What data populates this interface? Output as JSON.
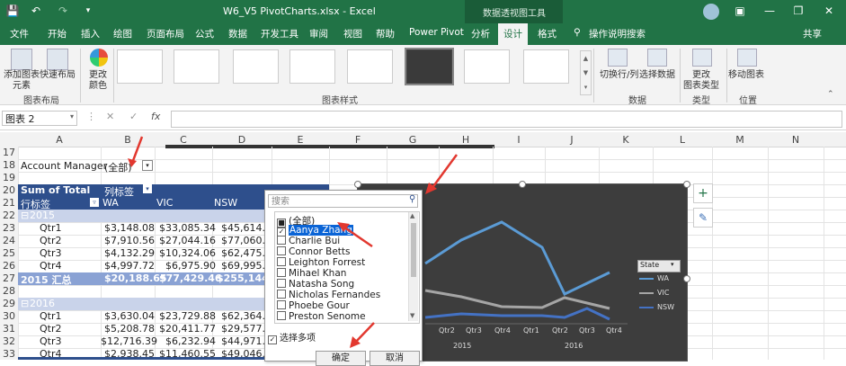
{
  "titlebar": {
    "title": "W6_V5 PivotCharts.xlsx  -  Excel",
    "context_tab_group": "数据透视图工具"
  },
  "tabs": [
    "文件",
    "开始",
    "插入",
    "绘图",
    "页面布局",
    "公式",
    "数据",
    "开发工具",
    "审阅",
    "视图",
    "帮助",
    "Power Pivot",
    "分析",
    "设计",
    "格式"
  ],
  "tell_me": "操作说明搜索",
  "share": "共享",
  "ribbon": {
    "add_chart_element": "添加图表\n元素",
    "quick_layout": "快速布局",
    "change_colors": "更改\n颜色",
    "group_chart_layouts": "图表布局",
    "group_chart_styles": "图表样式",
    "switch_row_col": "切换行/列",
    "select_data": "选择数据",
    "group_data": "数据",
    "change_chart_type": "更改\n图表类型",
    "group_type": "类型",
    "move_chart": "移动图表",
    "group_location": "位置"
  },
  "formula_bar": {
    "name_box": "图表 2",
    "fx": "fx"
  },
  "columns": [
    "A",
    "B",
    "C",
    "D",
    "E",
    "F",
    "G",
    "H",
    "I",
    "J",
    "K",
    "L",
    "M",
    "N"
  ],
  "rows": [
    "17",
    "18",
    "19",
    "20",
    "21",
    "22",
    "23",
    "24",
    "25",
    "26",
    "27",
    "28",
    "29",
    "30",
    "31",
    "32",
    "33"
  ],
  "sheet": {
    "filter_label": "Account Manager",
    "filter_value": "(全部)",
    "sum_of_total": "Sum of Total",
    "col_labels": "列标签",
    "row_labels": "行标签",
    "states": [
      "WA",
      "VIC",
      "NSW"
    ],
    "year_2015": "2015",
    "year_2016": "2016",
    "rows_2015": [
      {
        "q": "Qtr1",
        "wa": "$3,148.08",
        "vic": "$33,085.34",
        "nsw": "$45,614.3"
      },
      {
        "q": "Qtr2",
        "wa": "$7,910.56",
        "vic": "$27,044.16",
        "nsw": "$77,060.2"
      },
      {
        "q": "Qtr3",
        "wa": "$4,132.29",
        "vic": "$10,324.06",
        "nsw": "$62,475.2"
      },
      {
        "q": "Qtr4",
        "wa": "$4,997.72",
        "vic": "$6,975.90",
        "nsw": "$69,995.0"
      }
    ],
    "total_2015": {
      "label": "2015 汇总",
      "wa": "$20,188.65",
      "vic": "$77,429.46",
      "nsw": "$255,144.8"
    },
    "rows_2016": [
      {
        "q": "Qtr1",
        "wa": "$3,630.04",
        "vic": "$23,729.88",
        "nsw": "$62,364.5"
      },
      {
        "q": "Qtr2",
        "wa": "$5,208.78",
        "vic": "$20,411.77",
        "nsw": "$29,577.6"
      },
      {
        "q": "Qtr3",
        "wa": "$12,716.39",
        "vic": "$6,232.94",
        "nsw": "$44,971.1"
      },
      {
        "q": "Qtr4",
        "wa": "$2,938.45",
        "vic": "$11,460.55",
        "nsw": "$49,046.5"
      }
    ]
  },
  "filter_popup": {
    "search_placeholder": "搜索",
    "items": [
      {
        "label": "(全部)",
        "state": "mixed"
      },
      {
        "label": "Aanya Zhang",
        "state": "checked"
      },
      {
        "label": "Charlie Bui",
        "state": "unchecked"
      },
      {
        "label": "Connor Betts",
        "state": "unchecked"
      },
      {
        "label": "Leighton Forrest",
        "state": "unchecked"
      },
      {
        "label": "Mihael Khan",
        "state": "unchecked"
      },
      {
        "label": "Natasha Song",
        "state": "unchecked"
      },
      {
        "label": "Nicholas Fernandes",
        "state": "unchecked"
      },
      {
        "label": "Phoebe Gour",
        "state": "unchecked"
      },
      {
        "label": "Preston Senome",
        "state": "unchecked"
      }
    ],
    "multi_select_label": "选择多项",
    "ok": "确定",
    "cancel": "取消"
  },
  "chart": {
    "legend_title": "State",
    "legend": [
      "WA",
      "VIC",
      "NSW"
    ],
    "x_quarters": [
      "Qtr2",
      "Qtr3",
      "Qtr4",
      "Qtr1",
      "Qtr2",
      "Qtr3",
      "Qtr4"
    ],
    "x_years": [
      "2015",
      "2016"
    ],
    "colors": {
      "WA": "#5b9bd5",
      "VIC": "#a5a5a5",
      "NSW": "#4472c4",
      "background": "#3d3d3d"
    }
  },
  "colors": {
    "excel_green": "#217346",
    "pivot_header": "#2e4f8c",
    "annotation_red": "#e2382f"
  }
}
